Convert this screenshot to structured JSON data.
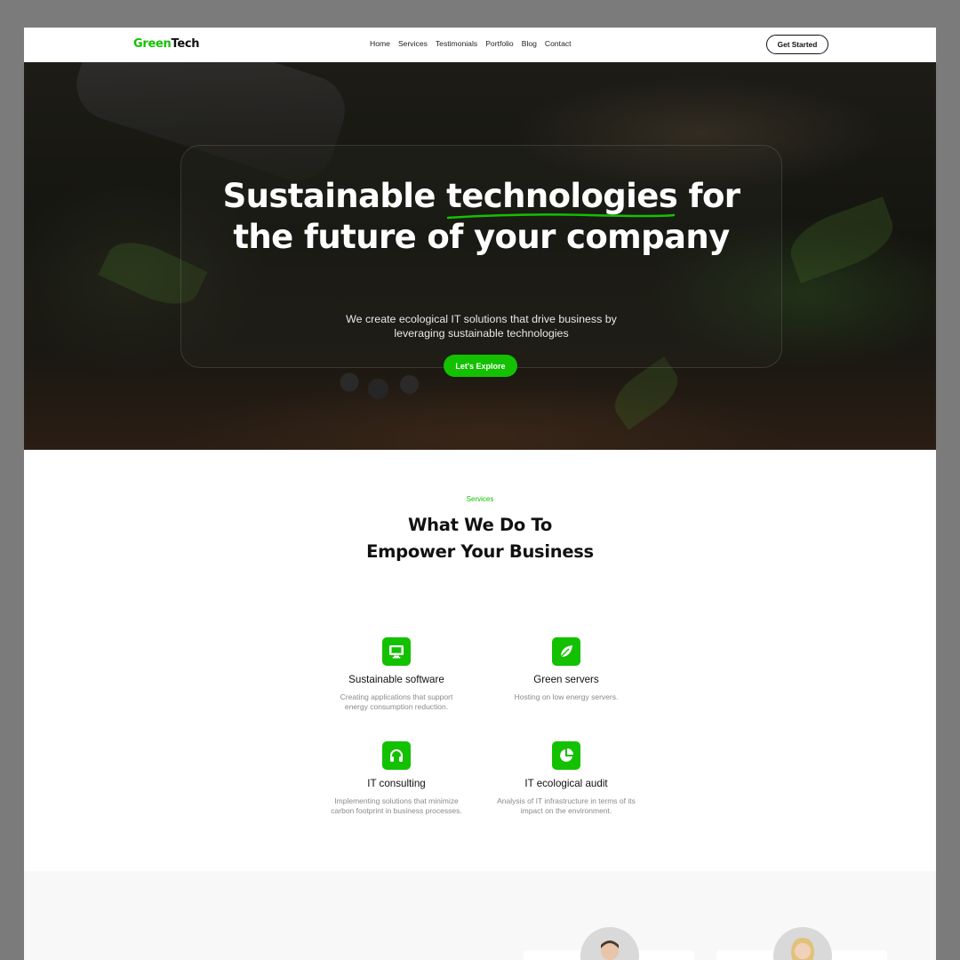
{
  "nav": {
    "logo_green": "Green",
    "logo_dark": "Tech",
    "items": [
      "Home",
      "Services",
      "Testimonials",
      "Portfolio",
      "Blog",
      "Contact"
    ],
    "cta": "Get Started"
  },
  "hero": {
    "title_pre": "Sustainable ",
    "title_highlight": "technologies",
    "title_post": " for",
    "title_line2": "the future of your company",
    "subtitle_line1": "We create ecological IT solutions that drive business by",
    "subtitle_line2": "leveraging sustainable technologies",
    "button": "Let's Explore"
  },
  "services": {
    "eyebrow": "Services",
    "title_line1": "What We Do To",
    "title_line2": "Empower Your Business",
    "items": [
      {
        "title": "Sustainable software",
        "desc": "Creating applications that support energy consumption reduction.",
        "icon": "monitor-icon"
      },
      {
        "title": "Green servers",
        "desc": "Hosting on low energy servers.",
        "icon": "leaf-icon"
      },
      {
        "title": "IT consulting",
        "desc": "Implementing solutions that minimize carbon footprint in business processes.",
        "icon": "headphones-icon"
      },
      {
        "title": "IT ecological audit",
        "desc": "Analysis of IT infrastructure in terms of its impact on the environment.",
        "icon": "pie-chart-icon"
      }
    ]
  },
  "colors": {
    "accent": "#13c100",
    "text": "#111111",
    "muted": "#8a8a8a",
    "frame": "#7b7b7b"
  }
}
